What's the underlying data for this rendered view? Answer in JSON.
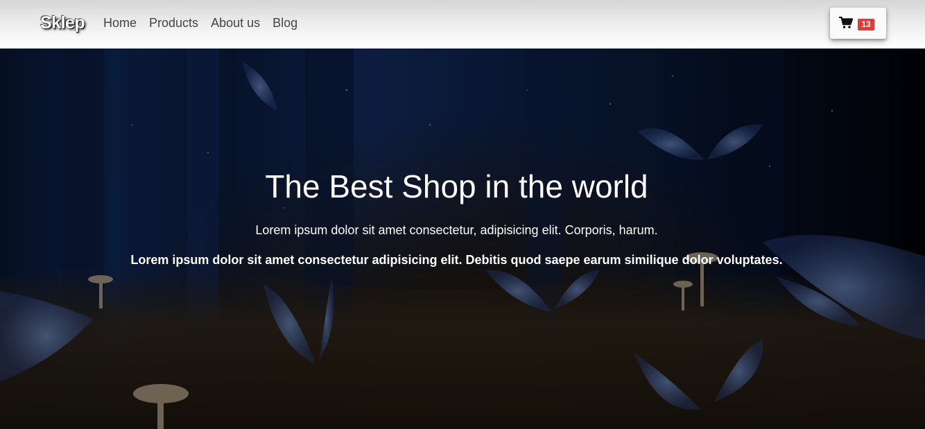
{
  "navbar": {
    "brand": "Sklep",
    "links": [
      "Home",
      "Products",
      "About us",
      "Blog"
    ],
    "cart": {
      "icon": "shopping-cart-icon",
      "count": "13"
    }
  },
  "hero": {
    "title": "The Best Shop in the world",
    "subtitle1": "Lorem ipsum dolor sit amet consectetur, adipisicing elit. Corporis, harum.",
    "subtitle2": "Lorem ipsum dolor sit amet consectetur adipisicing elit. Debitis quod saepe earum similique dolor voluptates."
  },
  "colors": {
    "badge": "#e53935",
    "hero_dark": "#0a1a3a",
    "butterfly": "#5c7ab8"
  }
}
